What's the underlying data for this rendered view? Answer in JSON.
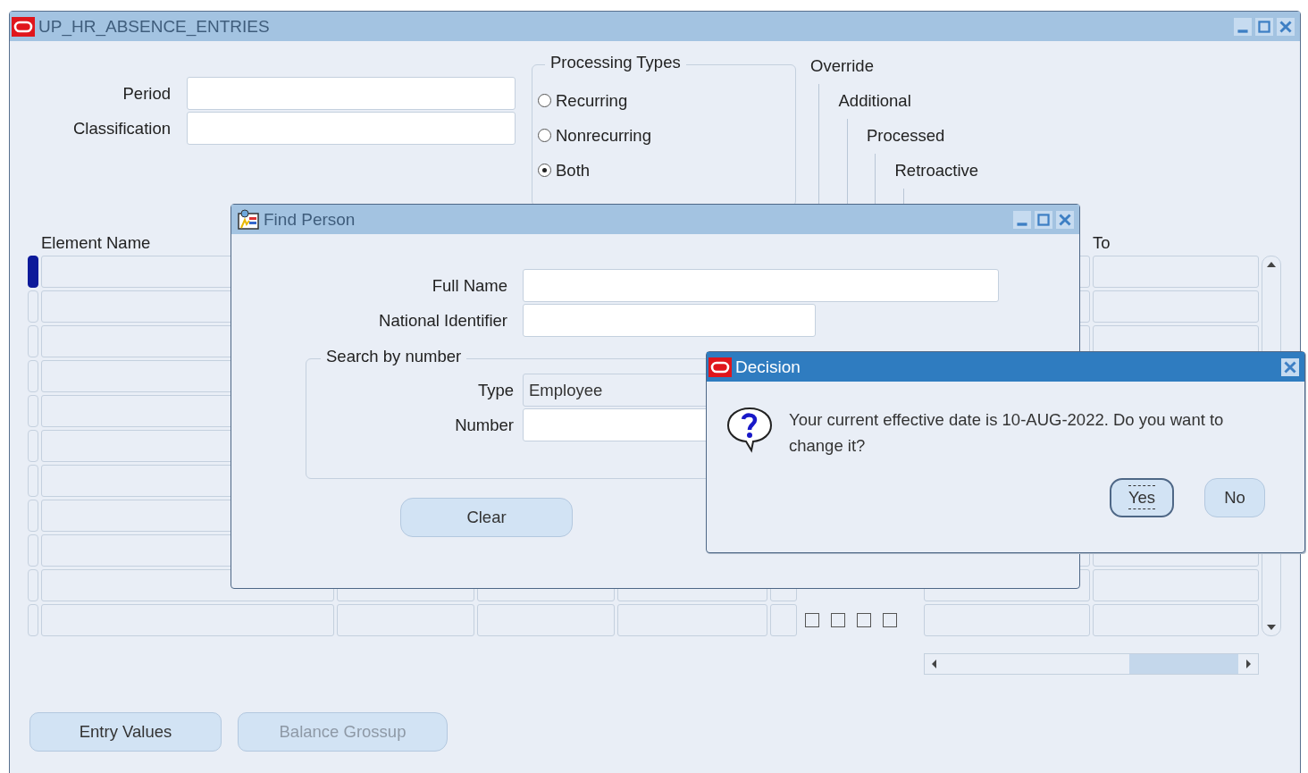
{
  "main_window": {
    "title": "UP_HR_ABSENCE_ENTRIES",
    "fields": [
      {
        "label": "Period"
      },
      {
        "label": "Classification"
      }
    ],
    "processing_types": {
      "title": "Processing Types",
      "options": [
        {
          "label": "Recurring",
          "selected": false
        },
        {
          "label": "Nonrecurring",
          "selected": false
        },
        {
          "label": "Both",
          "selected": true
        }
      ]
    },
    "flag_headers": [
      "Override",
      "Additional",
      "Processed",
      "Retroactive"
    ],
    "table": {
      "column_headers": [
        "Element Name",
        "To"
      ],
      "rows": [
        {
          "selected": true
        },
        {
          "selected": false
        },
        {
          "selected": false
        },
        {
          "selected": false
        },
        {
          "selected": false
        },
        {
          "selected": false
        },
        {
          "selected": false
        },
        {
          "selected": false
        },
        {
          "selected": false
        },
        {
          "selected": false
        },
        {
          "selected": false
        }
      ],
      "last_row_checkboxes": [
        {
          "checked": false
        },
        {
          "checked": false
        },
        {
          "checked": false
        },
        {
          "checked": false
        }
      ]
    },
    "buttons": [
      {
        "label": "Entry Values",
        "disabled": false
      },
      {
        "label": "Balance Grossup",
        "disabled": true
      }
    ]
  },
  "find_person": {
    "title": "Find Person",
    "fields": [
      {
        "label": "Full Name"
      },
      {
        "label": "National Identifier"
      }
    ],
    "search_by_number": {
      "title": "Search by number",
      "type_label": "Type",
      "type_value": "Employee",
      "number_label": "Number"
    },
    "buttons": [
      {
        "label": "Clear"
      }
    ]
  },
  "decision": {
    "title": "Decision",
    "message": "Your current effective date is 10-AUG-2022. Do you want to change it?",
    "buttons": [
      {
        "label": "Yes",
        "focused": true
      },
      {
        "label": "No",
        "focused": false
      }
    ]
  }
}
